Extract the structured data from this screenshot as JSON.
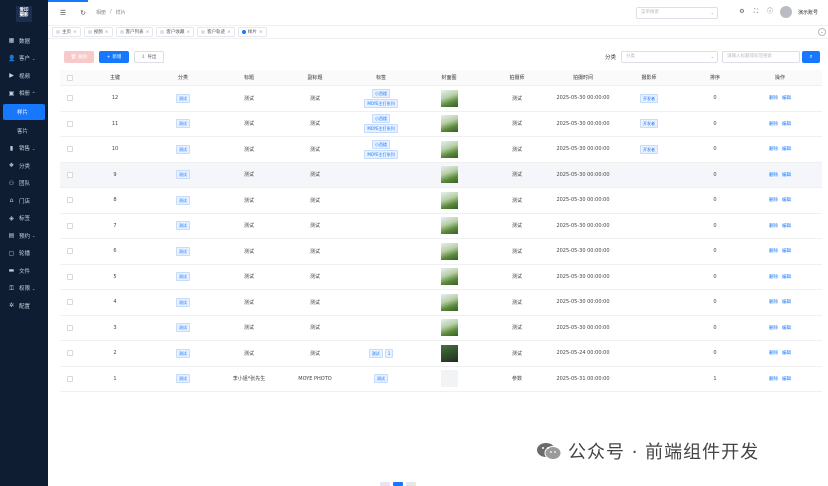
{
  "sidebar": {
    "logo_lines": [
      "爱印",
      "摄影"
    ],
    "items": [
      {
        "label": "数据",
        "icon": "dashboard-icon"
      },
      {
        "label": "客户",
        "icon": "user-icon",
        "arrow": "⌄"
      },
      {
        "label": "视频",
        "icon": "video-icon"
      },
      {
        "label": "相册",
        "icon": "album-icon",
        "arrow": "^"
      },
      {
        "label": "样片",
        "icon": "",
        "active": true,
        "sub": true
      },
      {
        "label": "客片",
        "icon": "",
        "sub": true
      },
      {
        "label": "销售",
        "icon": "chart-icon",
        "arrow": "⌄"
      },
      {
        "label": "分类",
        "icon": "category-icon"
      },
      {
        "label": "团队",
        "icon": "team-icon"
      },
      {
        "label": "门店",
        "icon": "store-icon"
      },
      {
        "label": "标签",
        "icon": "tag-icon"
      },
      {
        "label": "预约",
        "icon": "calendar-icon",
        "arrow": "⌄"
      },
      {
        "label": "轮播",
        "icon": "carousel-icon"
      },
      {
        "label": "文件",
        "icon": "folder-icon"
      },
      {
        "label": "权限",
        "icon": "lock-icon",
        "arrow": "⌄"
      },
      {
        "label": "配置",
        "icon": "gear-icon"
      }
    ]
  },
  "header": {
    "breadcrumb": [
      "相册",
      "/",
      "样片"
    ],
    "search_placeholder": "菜单搜索",
    "user_name": "演示账号"
  },
  "tabs": [
    {
      "label": "主页"
    },
    {
      "label": "视频"
    },
    {
      "label": "客户列表"
    },
    {
      "label": "客户收藏"
    },
    {
      "label": "客户轨迹"
    },
    {
      "label": "样片",
      "active": true
    }
  ],
  "toolbar": {
    "delete_label": "删除",
    "add_label": "新增",
    "export_label": "导出",
    "filter_label": "分类",
    "filter_placeholder": "分类",
    "search_placeholder": "请输入标题或标签搜索"
  },
  "table": {
    "headers": [
      "主键",
      "分类",
      "标题",
      "副标题",
      "标签",
      "封面图",
      "拍摄师",
      "拍摄时间",
      "摄影师",
      "排序",
      "操作"
    ],
    "rows": [
      {
        "id": "12",
        "cat": "测试",
        "title": "测试",
        "sub": "测试",
        "tags": [
          "小西楼",
          "MOYE主打系列"
        ],
        "img": "photo",
        "by": "测试",
        "time": "2025-05-30 00:00:00",
        "camera": "开发者",
        "sort": "0"
      },
      {
        "id": "11",
        "cat": "测试",
        "title": "测试",
        "sub": "测试",
        "tags": [
          "小西楼",
          "MOYE主打系列"
        ],
        "img": "photo",
        "by": "测试",
        "time": "2025-05-30 00:00:00",
        "camera": "开发者",
        "sort": "0"
      },
      {
        "id": "10",
        "cat": "测试",
        "title": "测试",
        "sub": "测试",
        "tags": [
          "小西楼",
          "MOYE主打系列"
        ],
        "img": "photo",
        "by": "测试",
        "time": "2025-05-30 00:00:00",
        "camera": "开发者",
        "sort": "0"
      },
      {
        "id": "9",
        "cat": "测试",
        "title": "测试",
        "sub": "测试",
        "tags": [],
        "img": "photo",
        "by": "测试",
        "time": "2025-05-30 00:00:00",
        "camera": "",
        "sort": "0",
        "hl": true
      },
      {
        "id": "8",
        "cat": "测试",
        "title": "测试",
        "sub": "测试",
        "tags": [],
        "img": "photo",
        "by": "测试",
        "time": "2025-05-30 00:00:00",
        "camera": "",
        "sort": "0"
      },
      {
        "id": "7",
        "cat": "测试",
        "title": "测试",
        "sub": "测试",
        "tags": [],
        "img": "photo",
        "by": "测试",
        "time": "2025-05-30 00:00:00",
        "camera": "",
        "sort": "0"
      },
      {
        "id": "6",
        "cat": "测试",
        "title": "测试",
        "sub": "测试",
        "tags": [],
        "img": "photo",
        "by": "测试",
        "time": "2025-05-30 00:00:00",
        "camera": "",
        "sort": "0"
      },
      {
        "id": "5",
        "cat": "测试",
        "title": "测试",
        "sub": "测试",
        "tags": [],
        "img": "photo",
        "by": "测试",
        "time": "2025-05-30 00:00:00",
        "camera": "",
        "sort": "0"
      },
      {
        "id": "4",
        "cat": "测试",
        "title": "测试",
        "sub": "测试",
        "tags": [],
        "img": "photo",
        "by": "测试",
        "time": "2025-05-30 00:00:00",
        "camera": "",
        "sort": "0"
      },
      {
        "id": "3",
        "cat": "测试",
        "title": "测试",
        "sub": "测试",
        "tags": [],
        "img": "photo",
        "by": "测试",
        "time": "2025-05-30 00:00:00",
        "camera": "",
        "sort": "0"
      },
      {
        "id": "2",
        "cat": "测试",
        "title": "测试",
        "sub": "测试",
        "tags": [
          "测试",
          "1"
        ],
        "img": "dark",
        "by": "测试",
        "time": "2025-05-24 00:00:00",
        "camera": "",
        "sort": "0"
      },
      {
        "id": "1",
        "cat": "测试",
        "title": "李小姐*张先生",
        "sub": "MOYE PHOTO",
        "tags": [
          "测试"
        ],
        "img": "empty",
        "by": "参数",
        "time": "2025-05-31 00:00:00",
        "camera": "",
        "sort": "1"
      }
    ],
    "op_delete": "删除",
    "op_edit": "编辑"
  },
  "watermark": {
    "text": "公众号 · 前端组件开发"
  }
}
